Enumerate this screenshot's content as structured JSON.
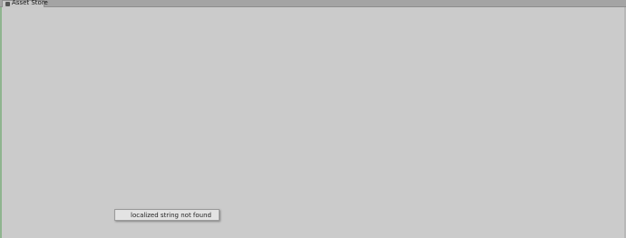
{
  "window": {
    "tab_label": "Asset Store",
    "tab_icon": "asset-store-icon"
  },
  "notice": {
    "text": "localized string not found"
  },
  "colors": {
    "background": "#cbcbcb",
    "tabbar": "#a4a4a4"
  }
}
